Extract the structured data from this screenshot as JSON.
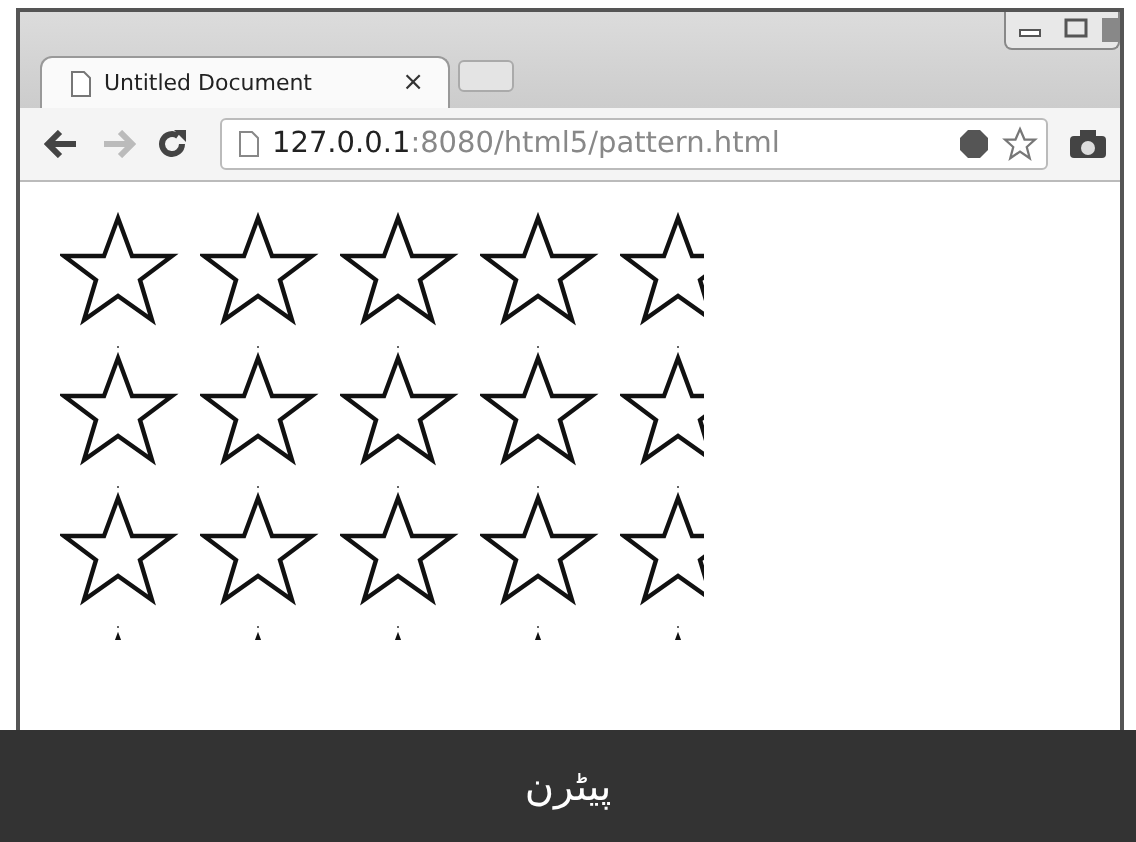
{
  "browser": {
    "tabs": [
      {
        "title": "Untitled Document",
        "close": "×",
        "selected": true
      }
    ],
    "address": {
      "host": "127.0.0.1",
      "path": ":8080/html5/pattern.html"
    }
  },
  "page": {
    "canvas": {
      "kind": "star-pattern"
    }
  },
  "caption": "پیٹرن"
}
